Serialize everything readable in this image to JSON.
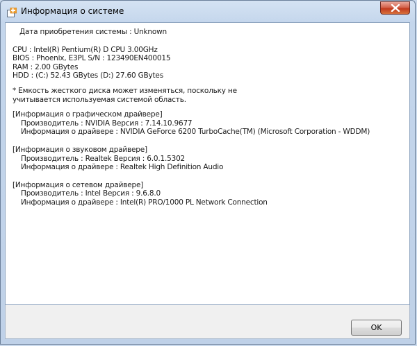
{
  "window": {
    "title": "Информация о системе",
    "title_icon": "system-info-icon",
    "close_icon": "close-icon",
    "close_color": "#c23a1e"
  },
  "info": {
    "purchase_date": "Дата приобретения системы : Unknown",
    "cpu": "CPU : Intel(R) Pentium(R) D CPU 3.00GHz",
    "bios": "BIOS : Phoenix, E3PL   S/N : 123490EN400015",
    "ram": "RAM : 2.00 GBytes",
    "hdd": "HDD : (C:) 52.43 GBytes (D:) 27.60 GBytes",
    "note_1": "* Емкость жесткого диска может изменяться, поскольку не",
    "note_2": "учитывается используемая системой область.",
    "graphics": {
      "header": "[Информация о графическом драйвере]",
      "vendor": "Производитель : NVIDIA    Версия : 7.14.10.9677",
      "driver": "Информация о драйвере   : NVIDIA GeForce 6200 TurboCache(TM) (Microsoft Corporation - WDDM)"
    },
    "audio": {
      "header": "[Информация о звуковом драйвере]",
      "vendor": "Производитель : Realtek    Версия : 6.0.1.5302",
      "driver": "Информация о драйвере   : Realtek High Definition Audio"
    },
    "network": {
      "header": "[Информация о сетевом драйвере]",
      "vendor": "Производитель : Intel    Версия : 9.6.8.0",
      "driver": "Информация о драйвере   : Intel(R) PRO/1000 PL Network Connection"
    }
  },
  "footer": {
    "ok_label": "OK"
  }
}
